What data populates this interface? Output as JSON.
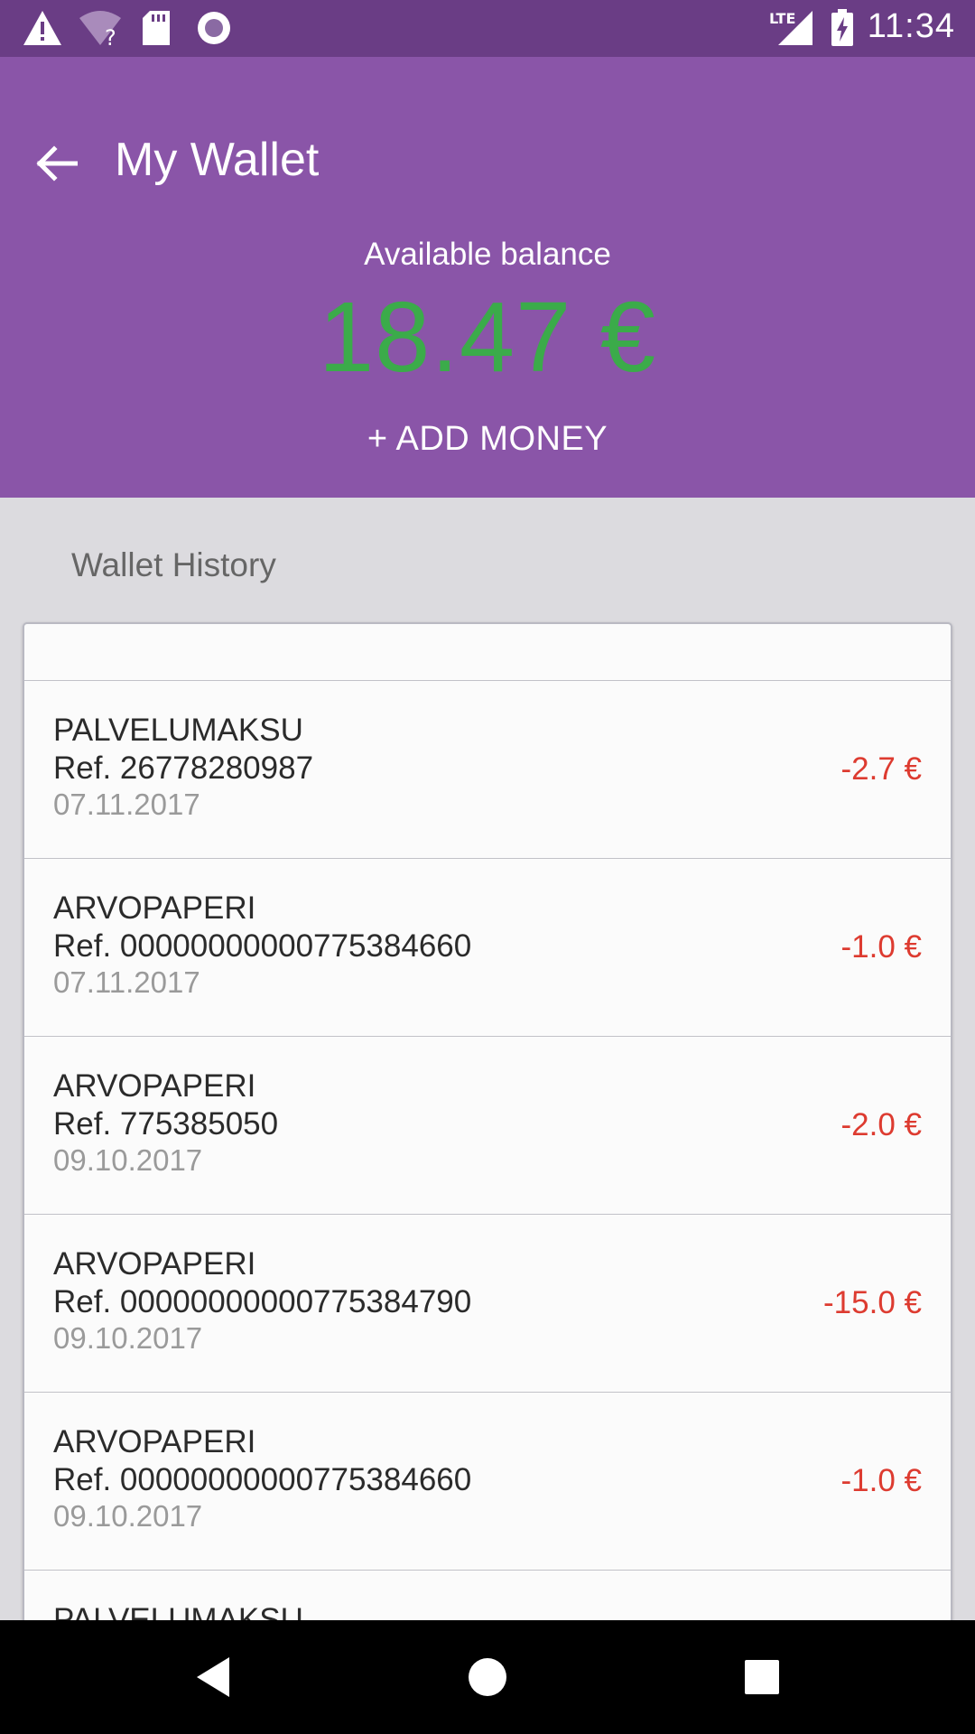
{
  "status_bar": {
    "time": "11:34",
    "network_label": "LTE",
    "icons": [
      "warning-icon",
      "wifi-unknown-icon",
      "sd-card-icon",
      "record-icon",
      "signal-icon",
      "battery-charging-icon"
    ]
  },
  "header": {
    "title": "My Wallet",
    "balance_label": "Available balance",
    "balance_value": "18.47 €",
    "add_money_label": "+ ADD MONEY"
  },
  "history": {
    "title": "Wallet History",
    "items": [
      {
        "name": "PALVELUMAKSU",
        "ref": "Ref. 26778280987",
        "date": "07.11.2017",
        "amount": "-2.7 €"
      },
      {
        "name": "ARVOPAPERI",
        "ref": "Ref. 00000000000775384660",
        "date": "07.11.2017",
        "amount": "-1.0 €"
      },
      {
        "name": "ARVOPAPERI",
        "ref": "Ref. 775385050",
        "date": "09.10.2017",
        "amount": "-2.0 €"
      },
      {
        "name": "ARVOPAPERI",
        "ref": "Ref. 00000000000775384790",
        "date": "09.10.2017",
        "amount": "-15.0 €"
      },
      {
        "name": "ARVOPAPERI",
        "ref": "Ref. 00000000000775384660",
        "date": "09.10.2017",
        "amount": "-1.0 €"
      },
      {
        "name": "PALVELUMAKSU",
        "ref": "",
        "date": "",
        "amount": ""
      }
    ]
  },
  "colors": {
    "status_bar": "#6a3d85",
    "header": "#8a55a8",
    "balance": "#3bab4a",
    "negative_amount": "#dd3b30",
    "background": "#dcdbdf"
  }
}
